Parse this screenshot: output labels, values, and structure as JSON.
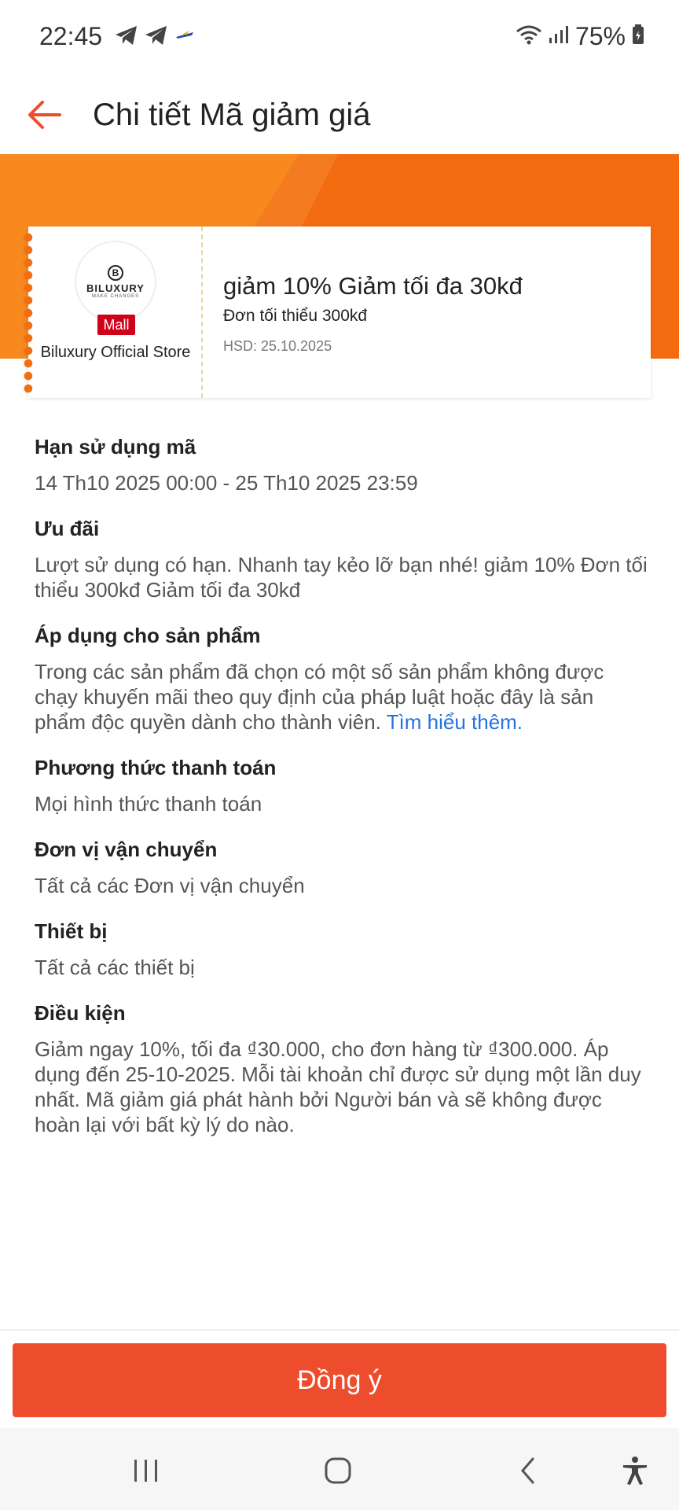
{
  "status": {
    "time": "22:45",
    "battery": "75%"
  },
  "header": {
    "title": "Chi tiết Mã giảm giá"
  },
  "voucher": {
    "store_name": "Biluxury Official Store",
    "logo_text": "BILUXURY",
    "logo_subtext": "MAKE CHANGES",
    "logo_mark": "B",
    "mall_badge": "Mall",
    "title": "giảm 10% Giảm tối đa 30kđ",
    "min_order": "Đơn tối thiểu 300kđ",
    "expiry": "HSD: 25.10.2025"
  },
  "sections": [
    {
      "heading": "Hạn sử dụng mã",
      "body": "14 Th10 2025 00:00 - 25 Th10 2025 23:59"
    },
    {
      "heading": "Ưu đãi",
      "body": "Lượt sử dụng có hạn. Nhanh tay kẻo lỡ bạn nhé! giảm 10% Đơn tối thiểu 300kđ Giảm tối đa 30kđ"
    },
    {
      "heading": "Áp dụng cho sản phẩm",
      "body": "Trong các sản phẩm đã chọn có một số sản phẩm không được chạy khuyến mãi theo quy định của pháp luật hoặc đây là sản phẩm độc quyền dành cho thành viên. ",
      "link": "Tìm hiểu thêm."
    },
    {
      "heading": "Phương thức thanh toán",
      "body": "Mọi hình thức thanh toán"
    },
    {
      "heading": "Đơn vị vận chuyển",
      "body": "Tất cả các Đơn vị vận chuyển"
    },
    {
      "heading": "Thiết bị",
      "body": "Tất cả các thiết bị"
    },
    {
      "heading": "Điều kiện",
      "body": "Giảm ngay 10%, tối đa ₫30.000, cho đơn hàng từ ₫300.000. Áp dụng đến 25-10-2025. Mỗi tài khoản chỉ được sử dụng một lần duy nhất. Mã giảm giá phát hành bởi Người bán và sẽ không được hoàn lại với bất kỳ lý do nào."
    }
  ],
  "footer": {
    "agree_label": "Đồng ý"
  },
  "icons": {
    "back": "arrow-left-icon",
    "telegram": "telegram-icon",
    "wifi": "wifi-icon",
    "signal": "signal-icon",
    "battery": "battery-icon",
    "nav_recent": "recent-apps-icon",
    "nav_home": "home-icon",
    "nav_back": "chevron-left-icon",
    "nav_accessibility": "accessibility-icon"
  },
  "colors": {
    "accent": "#ee4d2d",
    "banner": "#f36d12",
    "mall": "#d0011b",
    "link": "#2673dd"
  }
}
